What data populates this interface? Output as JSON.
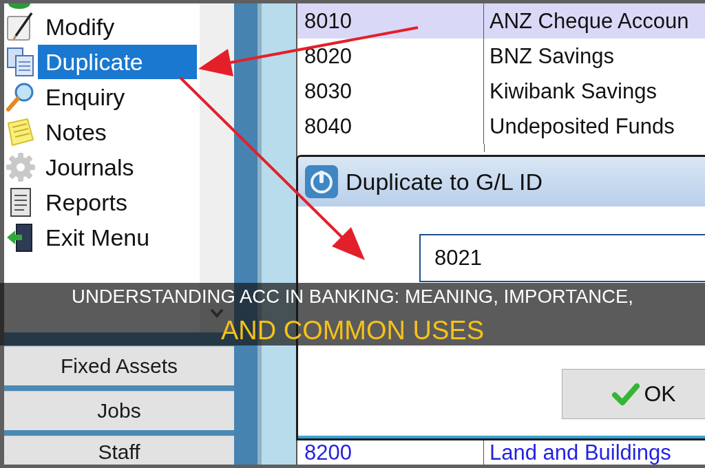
{
  "sidebar": {
    "menu_items": [
      {
        "label": "Modify",
        "selected": false
      },
      {
        "label": "Duplicate",
        "selected": true
      },
      {
        "label": "Enquiry",
        "selected": false
      },
      {
        "label": "Notes",
        "selected": false
      },
      {
        "label": "Journals",
        "selected": false
      },
      {
        "label": "Reports",
        "selected": false
      },
      {
        "label": "Exit Menu",
        "selected": false
      }
    ],
    "buttons": [
      {
        "label": "Fixed Assets"
      },
      {
        "label": "Jobs"
      },
      {
        "label": "Staff"
      }
    ]
  },
  "table": {
    "rows": [
      {
        "code": "8010",
        "name": "ANZ Cheque Accoun",
        "selected": true,
        "kind": "plain"
      },
      {
        "code": "8020",
        "name": "BNZ Savings",
        "selected": false,
        "kind": "plain"
      },
      {
        "code": "8030",
        "name": "Kiwibank Savings",
        "selected": false,
        "kind": "plain"
      },
      {
        "code": "8040",
        "name": "Undeposited Funds",
        "selected": false,
        "kind": "plain"
      }
    ],
    "lower_rows": [
      {
        "code": "8200",
        "name": "Land and Buildings",
        "selected": false,
        "kind": "link"
      }
    ]
  },
  "dialog": {
    "title": "Duplicate to G/L ID",
    "id_field": {
      "value": "8021"
    },
    "ok_button": {
      "label": "OK"
    }
  },
  "banner": {
    "lines": [
      {
        "text": "UNDERSTANDING ACC IN BANKING: MEANING, IMPORTANCE,",
        "kind": "headline",
        "color": "#ffffff"
      },
      {
        "text": "AND COMMON USES",
        "kind": "accent",
        "color": "#f5c21b"
      }
    ]
  }
}
